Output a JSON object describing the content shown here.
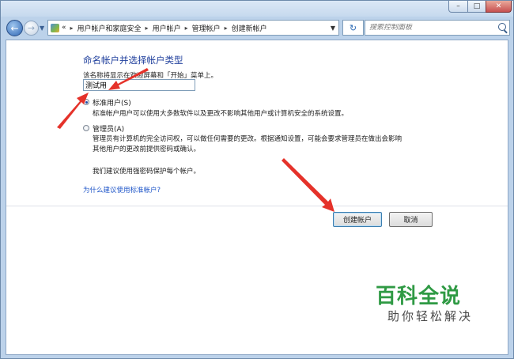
{
  "window": {
    "minimize_glyph": "–",
    "maximize_glyph": "□",
    "close_glyph": "✕"
  },
  "nav": {
    "back_icon": "back-arrow-icon",
    "forward_icon": "forward-arrow-icon",
    "breadcrumb_prefix": "«",
    "breadcrumbs": [
      "用户帐户和家庭安全",
      "用户帐户",
      "管理帐户",
      "创建新帐户"
    ],
    "refresh_icon": "refresh-icon",
    "search_placeholder": "搜索控制面板"
  },
  "form": {
    "heading": "命名帐户并选择帐户类型",
    "instruction": "该名称将显示在欢迎屏幕和「开始」菜单上。",
    "account_name_value": "测试用",
    "options": [
      {
        "label": "标准用户(S)",
        "selected": true,
        "description": "标准帐户用户可以使用大多数软件以及更改不影响其他用户或计算机安全的系统设置。"
      },
      {
        "label": "管理员(A)",
        "selected": false,
        "description_line1": "管理员有计算机的完全访问权，可以做任何需要的更改。根据通知设置，可能会要求管理员在做出会影响",
        "description_line2": "其他用户的更改前提供密码或确认。"
      }
    ],
    "recommendation": "我们建议使用强密码保护每个帐户。",
    "why_link": "为什么建议使用标准帐户?",
    "create_button": "创建帐户",
    "cancel_button": "取消"
  },
  "watermark": {
    "title": "百科全说",
    "subtitle": "助你轻松解决"
  },
  "colors": {
    "heading": "#1e3e9c",
    "link": "#1e55c8",
    "annotation_arrow": "#e5322a",
    "watermark_green": "#2f9a44"
  }
}
